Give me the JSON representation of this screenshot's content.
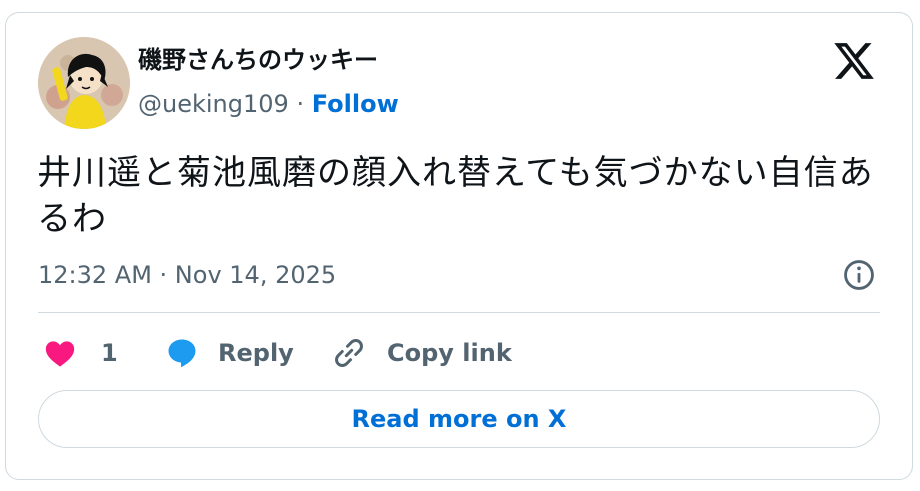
{
  "author": {
    "display_name": "磯野さんちのウッキー",
    "handle": "@ueking109",
    "separator": "·",
    "follow_label": "Follow"
  },
  "tweet": {
    "text": "井川遥と菊池風磨の顔入れ替えても気づかない自信あるわ",
    "timestamp": "12:32 AM · Nov 14, 2025"
  },
  "actions": {
    "like_count": "1",
    "reply_label": "Reply",
    "copy_link_label": "Copy link"
  },
  "read_more_label": "Read more on X",
  "colors": {
    "like": "#f91880",
    "reply": "#1d9bf0",
    "link": "#006fd6",
    "muted": "#536471",
    "border": "#cfd9de"
  },
  "icons": [
    "x-logo-icon",
    "info-icon",
    "heart-icon",
    "reply-bubble-icon",
    "link-icon"
  ]
}
